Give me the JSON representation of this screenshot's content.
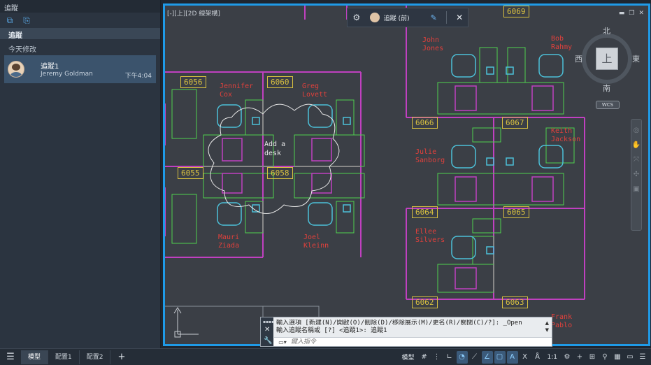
{
  "left_panel": {
    "title": "追蹤",
    "header": "追蹤",
    "section": "今天修改",
    "item": {
      "title": "追蹤1",
      "user": "Jeremy Goldman",
      "time": "下午4:04"
    },
    "toolbar_icons": [
      "new-track-icon",
      "track-list-icon"
    ]
  },
  "viewport": {
    "label": "[-][上][2D 線架構]",
    "track_toolbar": {
      "name": "追蹤 (前)"
    },
    "viewcube": {
      "north": "北",
      "south": "南",
      "east": "東",
      "west": "西",
      "face": "上",
      "wcs": "WCS"
    },
    "rooms": [
      "6069",
      "6056",
      "6060",
      "6066",
      "6067",
      "6055",
      "6058",
      "6064",
      "6065",
      "6062",
      "6063"
    ],
    "names": [
      "John\nJones",
      "Bob\nRahmy",
      "Jennifer\nCox",
      "Greg\nLovett",
      "Keith\nJackson",
      "Julie\nSanborg",
      "Mauri\nZiada",
      "Joel\nKleinn",
      "Ellee\nSilvers",
      "Frank\nPablo"
    ],
    "markup": "Add a\ndesk",
    "colors": {
      "frame": "#1f9be8",
      "room_label": "#d8c040",
      "name": "#e0403c",
      "furniture": "#4cc0d8",
      "wall_green": "#4fd04f",
      "wall_magenta": "#c040c0"
    }
  },
  "cmdline": {
    "history": [
      "輸入選項 [新建(N)/開啟(O)/刪除(D)/移除展示(M)/更名(R)/關閉(C)/?]: _Open",
      "輸入追蹤名稱或 [?] <追蹤1>: 追蹤1"
    ],
    "placeholder": "鍵入指令"
  },
  "statusbar": {
    "tabs": [
      "模型",
      "配置1",
      "配置2"
    ],
    "mode": "模型",
    "scale": "1:1"
  }
}
